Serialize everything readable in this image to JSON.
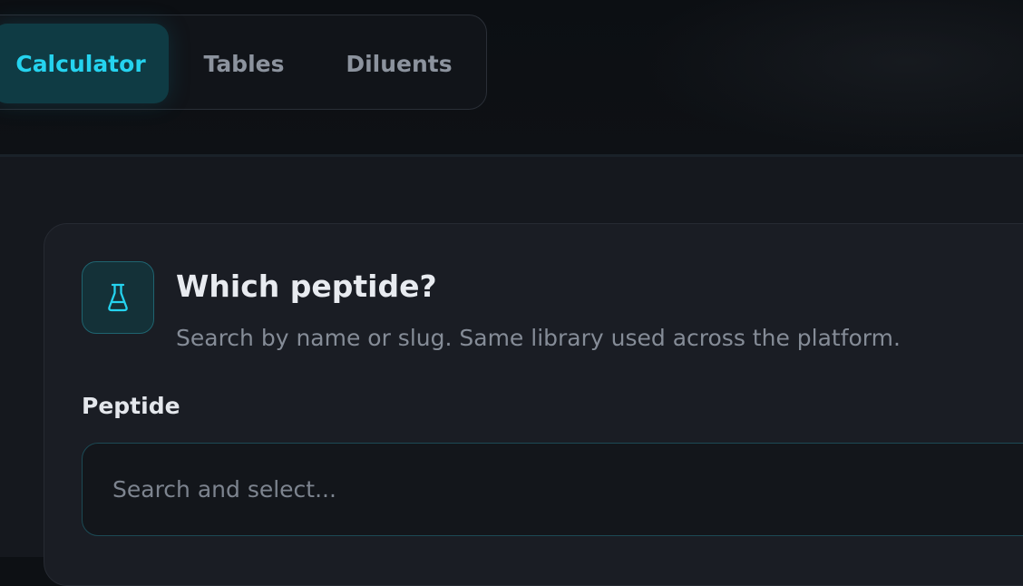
{
  "tabs": [
    {
      "label": "Calculator",
      "active": true
    },
    {
      "label": "Tables",
      "active": false
    },
    {
      "label": "Diluents",
      "active": false
    }
  ],
  "card": {
    "icon": "flask-icon",
    "title": "Which peptide?",
    "subtitle": "Search by name or slug. Same library used across the platform."
  },
  "peptide_field": {
    "label": "Peptide",
    "value": "",
    "placeholder": "Search and select..."
  },
  "colors": {
    "accent": "#25d3ef",
    "active_tab_bg": "#0f3b44",
    "background": "#0d1014",
    "card_bg": "#1a1d24"
  }
}
